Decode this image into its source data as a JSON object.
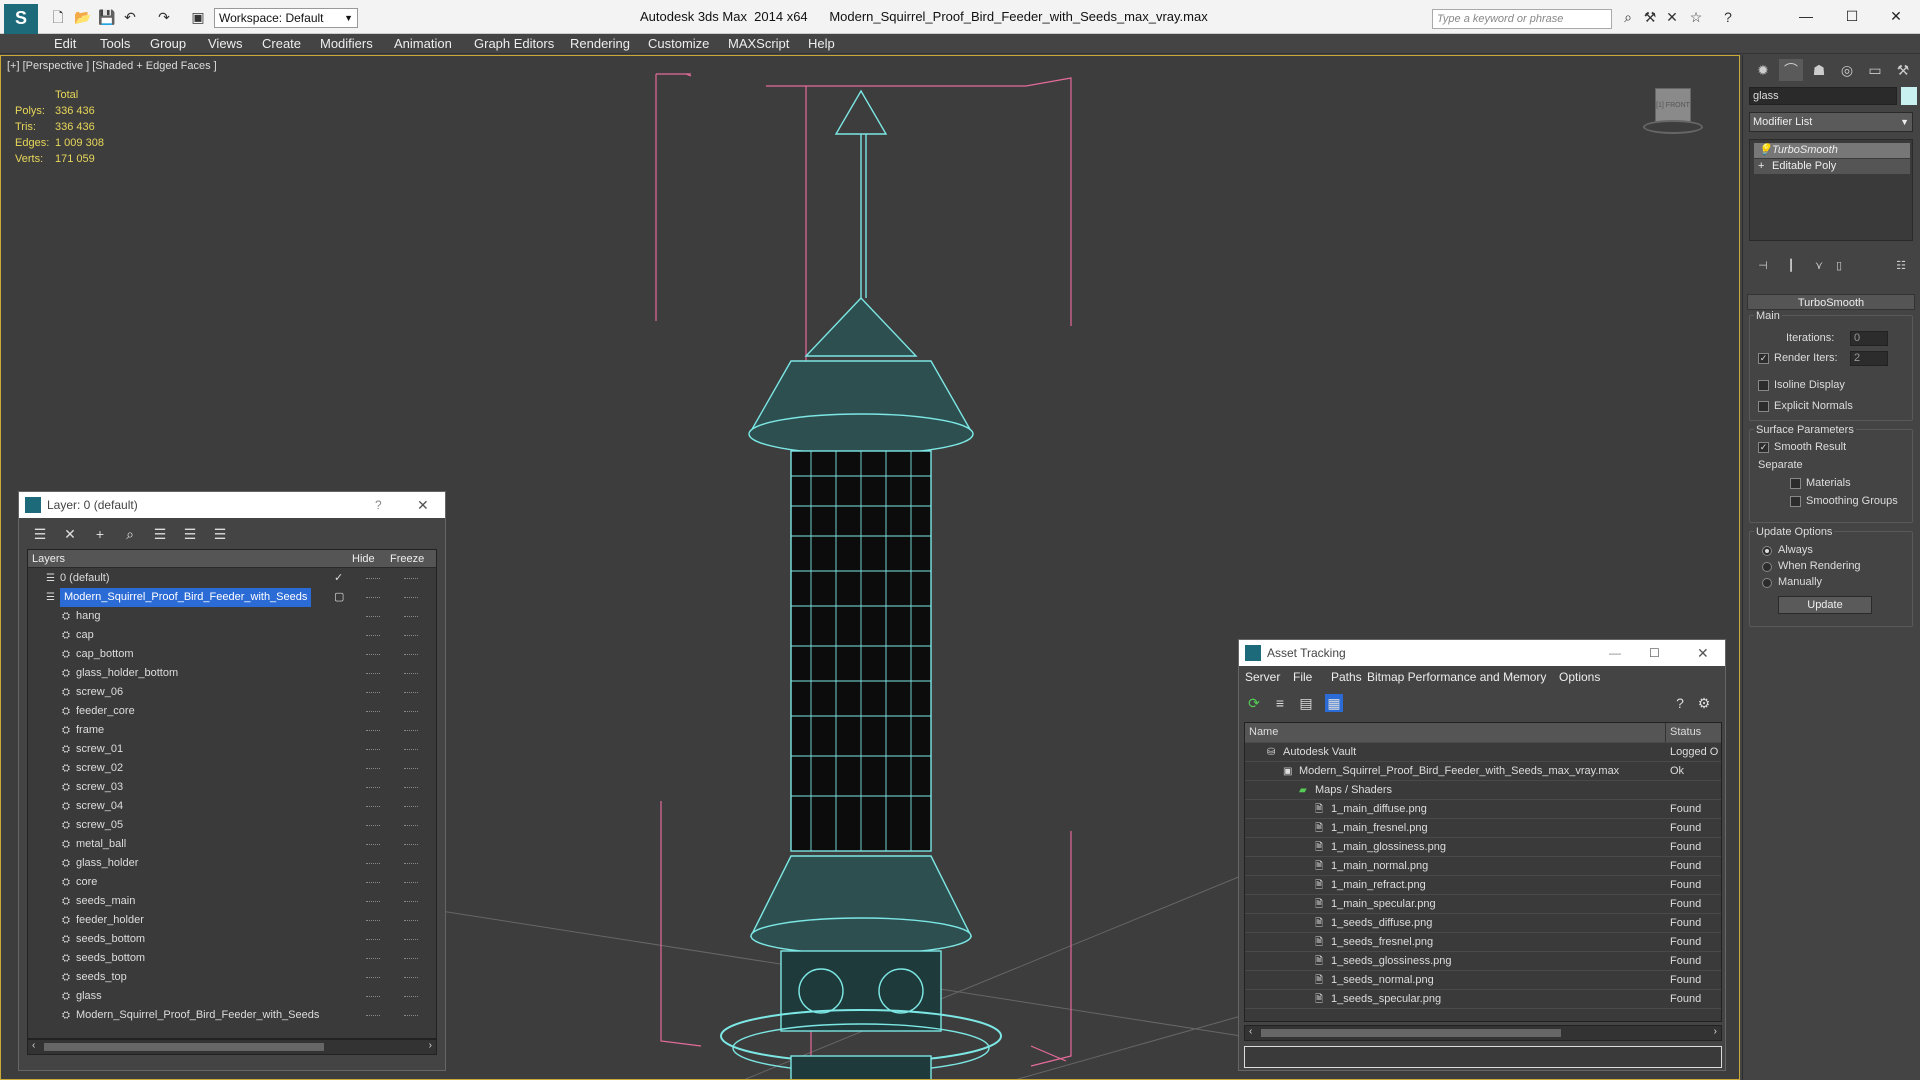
{
  "app": {
    "title": "Autodesk 3ds Max  2014 x64      Modern_Squirrel_Proof_Bird_Feeder_with_Seeds_max_vray.max",
    "workspace": "Workspace: Default",
    "search_placeholder": "Type a keyword or phrase"
  },
  "menu": [
    "Edit",
    "Tools",
    "Group",
    "Views",
    "Create",
    "Modifiers",
    "Animation",
    "Graph Editors",
    "Rendering",
    "Customize",
    "MAXScript",
    "Help"
  ],
  "viewport": {
    "label": "[+] [Perspective ] [Shaded + Edged Faces ]",
    "stats": {
      "total_label": "Total",
      "polys_label": "Polys:",
      "polys": "336 436",
      "tris_label": "Tris:",
      "tris": "336 436",
      "edges_label": "Edges:",
      "edges": "1 009 308",
      "verts_label": "Verts:",
      "verts": "171 059"
    },
    "viewcube_label": "[1] FRONT"
  },
  "command_panel": {
    "object_name": "glass",
    "object_color": "#c8f1ef",
    "modifier_list": "Modifier List",
    "stack": [
      "TurboSmooth",
      "Editable Poly"
    ],
    "turbosmooth": {
      "title": "TurboSmooth",
      "main": "Main",
      "iterations_label": "Iterations:",
      "iterations": "0",
      "render_iters_label": "Render Iters:",
      "render_iters": "2",
      "isoline": "Isoline Display",
      "explicit_normals": "Explicit Normals",
      "surface_params": "Surface Parameters",
      "smooth_result": "Smooth Result",
      "separate": "Separate",
      "materials": "Materials",
      "smoothing_groups": "Smoothing Groups",
      "update_options": "Update Options",
      "always": "Always",
      "when_rendering": "When Rendering",
      "manually": "Manually",
      "update_btn": "Update"
    }
  },
  "layer_dialog": {
    "title": "Layer: 0 (default)",
    "help": "?",
    "col_layers": "Layers",
    "col_hide": "Hide",
    "col_freeze": "Freeze",
    "rows": [
      {
        "name": "0 (default)",
        "level": 0
      },
      {
        "name": "Modern_Squirrel_Proof_Bird_Feeder_with_Seeds",
        "level": 0
      },
      {
        "name": "hang",
        "level": 1
      },
      {
        "name": "cap",
        "level": 1
      },
      {
        "name": "cap_bottom",
        "level": 1
      },
      {
        "name": "glass_holder_bottom",
        "level": 1
      },
      {
        "name": "screw_06",
        "level": 1
      },
      {
        "name": "feeder_core",
        "level": 1
      },
      {
        "name": "frame",
        "level": 1
      },
      {
        "name": "screw_01",
        "level": 1
      },
      {
        "name": "screw_02",
        "level": 1
      },
      {
        "name": "screw_03",
        "level": 1
      },
      {
        "name": "screw_04",
        "level": 1
      },
      {
        "name": "screw_05",
        "level": 1
      },
      {
        "name": "metal_ball",
        "level": 1
      },
      {
        "name": "glass_holder",
        "level": 1
      },
      {
        "name": "core",
        "level": 1
      },
      {
        "name": "seeds_main",
        "level": 1
      },
      {
        "name": "feeder_holder",
        "level": 1
      },
      {
        "name": "seeds_bottom",
        "level": 1
      },
      {
        "name": "seeds_bottom",
        "level": 1
      },
      {
        "name": "seeds_top",
        "level": 1
      },
      {
        "name": "glass",
        "level": 1
      },
      {
        "name": "Modern_Squirrel_Proof_Bird_Feeder_with_Seeds",
        "level": 1
      }
    ]
  },
  "asset_dialog": {
    "title": "Asset Tracking",
    "menu": [
      "Server",
      "File",
      "Paths",
      "Bitmap Performance and Memory",
      "Options"
    ],
    "col_name": "Name",
    "col_status": "Status",
    "rows": [
      {
        "name": "Autodesk Vault",
        "status": "Logged O",
        "level": 0
      },
      {
        "name": "Modern_Squirrel_Proof_Bird_Feeder_with_Seeds_max_vray.max",
        "status": "Ok",
        "level": 1
      },
      {
        "name": "Maps / Shaders",
        "status": "",
        "level": 2
      },
      {
        "name": "1_main_diffuse.png",
        "status": "Found",
        "level": 3
      },
      {
        "name": "1_main_fresnel.png",
        "status": "Found",
        "level": 3
      },
      {
        "name": "1_main_glossiness.png",
        "status": "Found",
        "level": 3
      },
      {
        "name": "1_main_normal.png",
        "status": "Found",
        "level": 3
      },
      {
        "name": "1_main_refract.png",
        "status": "Found",
        "level": 3
      },
      {
        "name": "1_main_specular.png",
        "status": "Found",
        "level": 3
      },
      {
        "name": "1_seeds_diffuse.png",
        "status": "Found",
        "level": 3
      },
      {
        "name": "1_seeds_fresnel.png",
        "status": "Found",
        "level": 3
      },
      {
        "name": "1_seeds_glossiness.png",
        "status": "Found",
        "level": 3
      },
      {
        "name": "1_seeds_normal.png",
        "status": "Found",
        "level": 3
      },
      {
        "name": "1_seeds_specular.png",
        "status": "Found",
        "level": 3
      }
    ]
  }
}
